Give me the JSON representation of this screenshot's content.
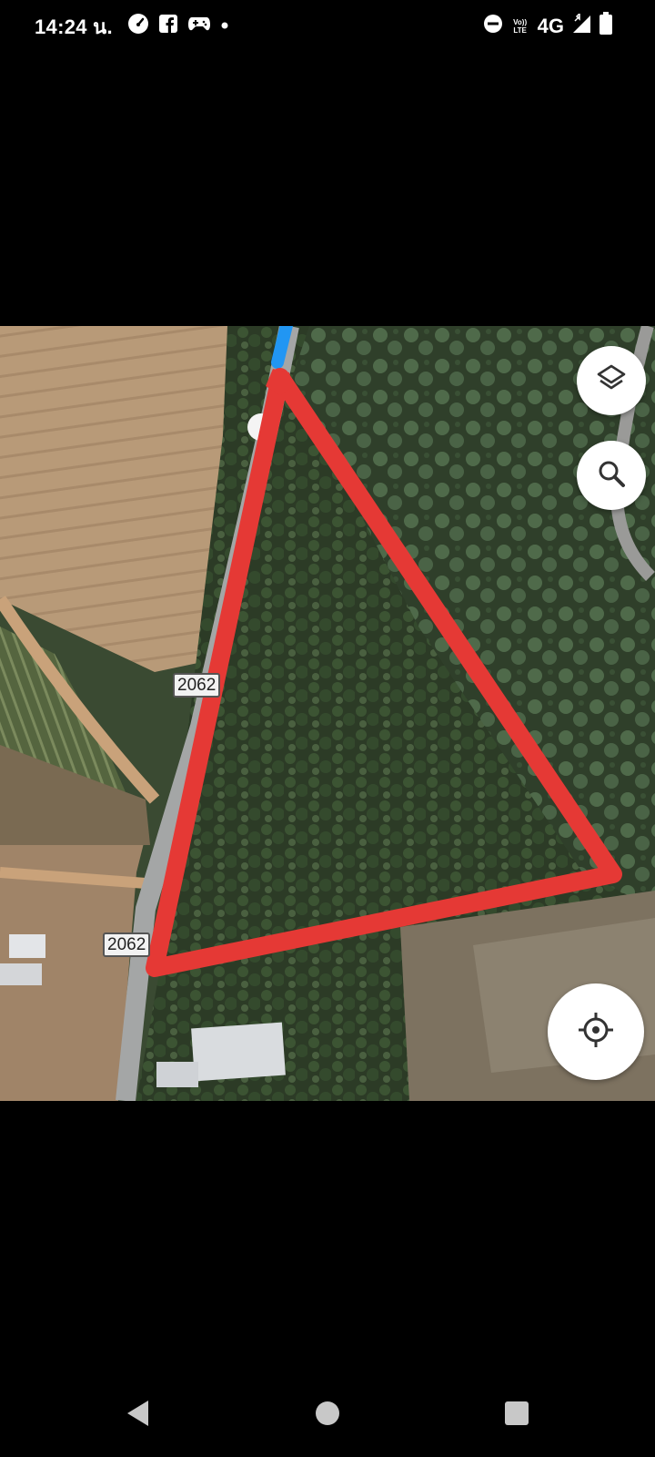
{
  "status_bar": {
    "time": "14:24 น.",
    "network": "4G",
    "volte_line1": "Vo))",
    "volte_line2": "LTE",
    "left_icons": [
      "speedometer-icon",
      "facebook-icon",
      "game-controller-icon",
      "notification-dot-icon"
    ],
    "right_icons": [
      "do-not-disturb-icon",
      "volte-icon",
      "signal-icon",
      "battery-icon"
    ]
  },
  "map": {
    "road_labels": [
      "2062",
      "2062"
    ],
    "boundary_color": "#e53935",
    "route_color": "#2196f3",
    "controls": {
      "layers": "layers-icon",
      "search": "search-icon",
      "locate": "my-location-icon"
    }
  },
  "nav_bar": {
    "back": "back-icon",
    "home": "home-icon",
    "recents": "recents-icon"
  }
}
